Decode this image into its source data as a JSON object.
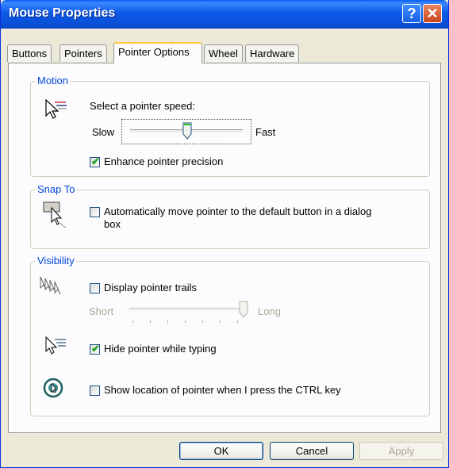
{
  "window": {
    "title": "Mouse Properties"
  },
  "titlebar": {
    "help_glyph": "?",
    "close_glyph": "✕"
  },
  "tabs": [
    "Buttons",
    "Pointers",
    "Pointer Options",
    "Wheel",
    "Hardware"
  ],
  "active_tab": "Pointer Options",
  "motion": {
    "legend": "Motion",
    "speed_label": "Select a pointer speed:",
    "slow": "Slow",
    "fast": "Fast",
    "speed_level": 0.5,
    "enhance_label": "Enhance pointer precision",
    "enhance_checked": true
  },
  "snap_to": {
    "legend": "Snap To",
    "auto_label_line1": "Automatically move pointer to the default button in a dialog",
    "auto_label_line2": "box",
    "auto_checked": false
  },
  "visibility": {
    "legend": "Visibility",
    "trails_label": "Display pointer trails",
    "trails_checked": false,
    "short": "Short",
    "long": "Long",
    "trail_level": 1.0,
    "hide_label": "Hide pointer while typing",
    "hide_checked": true,
    "show_location_label": "Show location of pointer when I press the CTRL key",
    "show_location_checked": false
  },
  "buttons": {
    "ok": "OK",
    "cancel": "Cancel",
    "apply": "Apply"
  },
  "colors": {
    "accent": "#0046D5",
    "titlebar": "#0A5CF0",
    "check": "#21A121",
    "close": "#C8451A"
  },
  "icons": [
    "pointer-speed-icon",
    "snap-to-icon",
    "pointer-trails-icon",
    "hide-pointer-icon",
    "pointer-location-icon"
  ]
}
